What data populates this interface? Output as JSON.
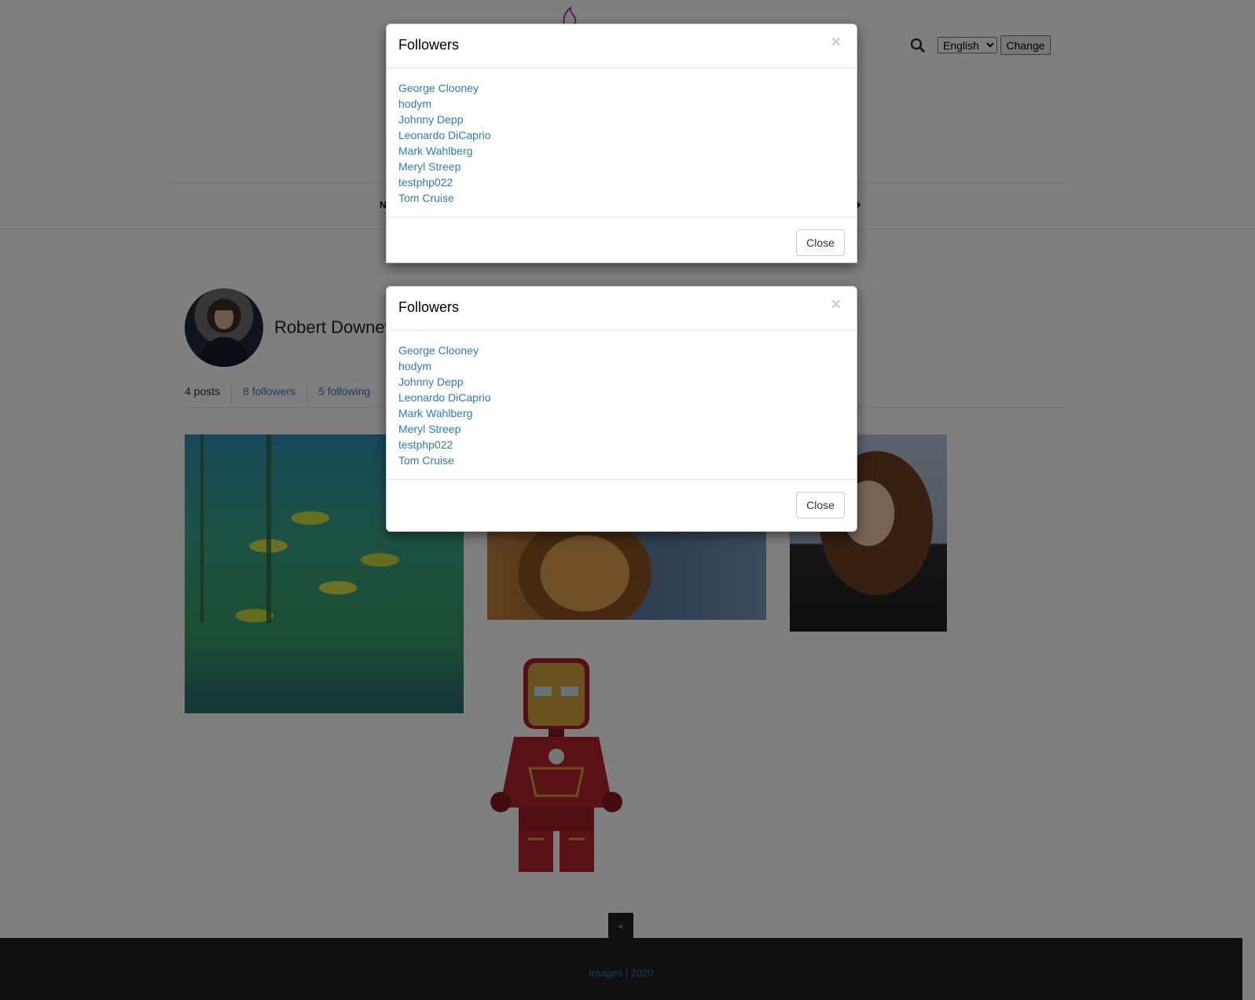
{
  "header": {
    "language_selected": "English",
    "language_options": [
      "English"
    ],
    "change_label": "Change",
    "nav_fragment_left": "N",
    "nav_fragment_right": "◆"
  },
  "profile": {
    "name": "Robert Downey",
    "posts": "4 posts",
    "followers": "8 followers",
    "following": "5 following"
  },
  "footer": {
    "text": "Images | 2020",
    "scroll_top_glyph": "«"
  },
  "modals": [
    {
      "title": "Followers",
      "close_x": "×",
      "followers": [
        "George Clooney",
        "hodym",
        "Johnny Depp",
        "Leonardo DiCaprio",
        "Mark Wahlberg",
        "Meryl Streep",
        "testphp022",
        "Tom Cruise"
      ],
      "close_label": "Close"
    },
    {
      "title": "Followers",
      "close_x": "×",
      "followers": [
        "George Clooney",
        "hodym",
        "Johnny Depp",
        "Leonardo DiCaprio",
        "Mark Wahlberg",
        "Meryl Streep",
        "testphp022",
        "Tom Cruise"
      ],
      "close_label": "Close"
    }
  ],
  "colors": {
    "link": "#337ab7",
    "footer_bg": "#1e1e1e",
    "logo": "#a0409a"
  }
}
